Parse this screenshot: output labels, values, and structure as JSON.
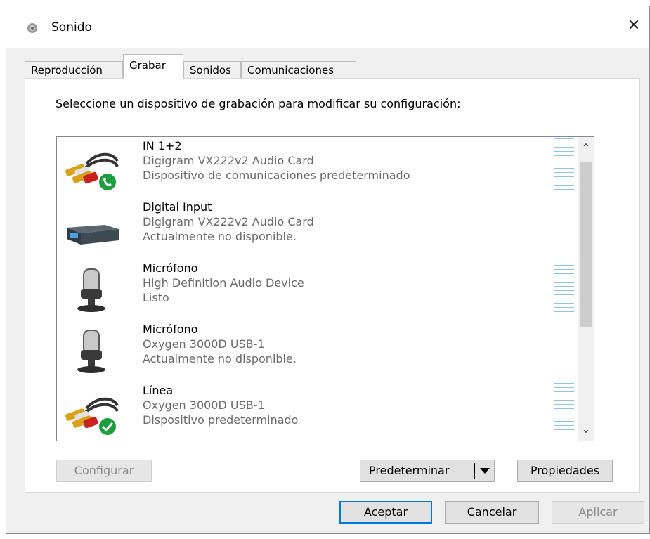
{
  "window": {
    "title": "Sonido",
    "close_label": "✕"
  },
  "tabs": [
    {
      "label": "Reproducción"
    },
    {
      "label": "Grabar"
    },
    {
      "label": "Sonidos"
    },
    {
      "label": "Comunicaciones"
    }
  ],
  "active_tab": "Grabar",
  "instruction": "Seleccione un dispositivo de grabación para modificar su configuración:",
  "devices": [
    {
      "name": "IN 1+2",
      "driver": "Digigram VX222v2 Audio Card",
      "status": "Dispositivo de comunicaciones predeterminado",
      "icon": "rca-cable-icon",
      "badge": "phone-badge",
      "meter": true
    },
    {
      "name": "Digital Input",
      "driver": "Digigram VX222v2 Audio Card",
      "status": "Actualmente no disponible.",
      "icon": "digital-input-box-icon",
      "badge": "",
      "meter": false
    },
    {
      "name": "Micrófono",
      "driver": "High Definition Audio Device",
      "status": "Listo",
      "icon": "microphone-icon",
      "badge": "",
      "meter": true
    },
    {
      "name": "Micrófono",
      "driver": "Oxygen 3000D USB-1",
      "status": "Actualmente no disponible.",
      "icon": "microphone-icon",
      "badge": "",
      "meter": false
    },
    {
      "name": "Línea",
      "driver": "Oxygen 3000D USB-1",
      "status": "Dispositivo predeterminado",
      "icon": "rca-cable-icon",
      "badge": "check-badge",
      "meter": true
    }
  ],
  "buttons": {
    "configure": "Configurar",
    "set_default": "Predeterminar",
    "properties": "Propiedades",
    "ok": "Aceptar",
    "cancel": "Cancelar",
    "apply": "Aplicar"
  },
  "colors": {
    "accent": "#0078d7",
    "meter": "#8fc6e8",
    "badge_green": "#1e9e3e"
  }
}
